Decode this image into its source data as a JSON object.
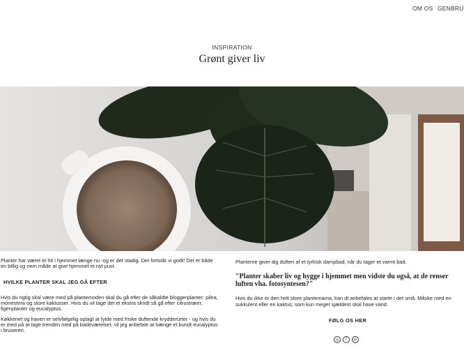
{
  "nav": {
    "items": [
      "OM OS",
      "GENBRUG"
    ]
  },
  "header": {
    "kicker": "INSPIRATION",
    "title": "Grønt giver liv"
  },
  "hero": {
    "alt": "hero-photo"
  },
  "left": {
    "p1": "Planter har været et hit i hjemmet længe nu -og er det stadig. Det fortstår vi godt! Det er både en billig og nem måde at give hjemmet et nyt pust.",
    "subhead": "HVILKE PLANTER SKAL JEG GÅ EFTER",
    "p2": "Hvis du rigtig skal være med på plantemoden skal du gå efter de såkaldte bloggerplanter: pilea, monestera og store kaktusser. Hvis du vil tage det et ekstra skridt så gå efter citrustræer, figenplanter og eucalyptus.",
    "p3": "Køkkenet og haven er selvfølgelig oplagt at fylde med friske duftende krydderurter - og hvis du er med på at tage trenden med på badeværelset, vil jeg anbefale at hænge et bundt eucalyptus i bruseren."
  },
  "right": {
    "p1": "Planterne giver dig duften af et tyrkisk dampbad, når du tager et varmt bad.",
    "quote": "\"Planter skaber liv og hygge i hjemmet men vidste du også, at de renser luften vha. fotosyntesen?\"",
    "p2": "Hvis du ikke er den helt store plantemama, kan dt anbefales at starte i det små. Måske med en sukkulent eller en kaktus, som kun meget sjældent skal have vand."
  },
  "follow": {
    "label": "FØLG OS HER"
  },
  "social": {
    "icons": [
      "instagram-icon",
      "facebook-icon",
      "pinterest-icon"
    ]
  }
}
